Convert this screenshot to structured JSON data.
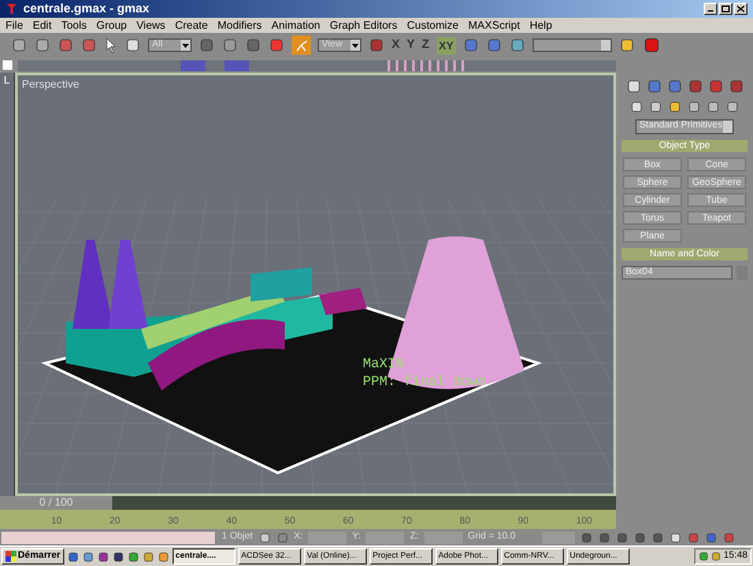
{
  "window": {
    "title": "centrale.gmax - gmax"
  },
  "menu": [
    "File",
    "Edit",
    "Tools",
    "Group",
    "Views",
    "Create",
    "Modifiers",
    "Animation",
    "Graph Editors",
    "Customize",
    "MAXScript",
    "Help"
  ],
  "toolbar": {
    "selection_filter": "All",
    "coordinate_system": "View",
    "axis_xy": "XY",
    "axis_x": "X",
    "axis_y": "Y",
    "axis_z": "Z"
  },
  "viewport": {
    "corner": "L",
    "label": "Perspective",
    "overlay_lines": [
      "MaXIN",
      "PPM: final down"
    ]
  },
  "command_panel": {
    "category": "Standard Primitives",
    "object_type": {
      "title": "Object Type",
      "buttons": [
        "Box",
        "Cone",
        "Sphere",
        "GeoSphere",
        "Cylinder",
        "Tube",
        "Torus",
        "Teapot",
        "Plane"
      ]
    },
    "name_and_color": {
      "title": "Name and Color",
      "name": "Box04",
      "color": "#7f7f7f"
    }
  },
  "time_slider": {
    "label": "0 / 100",
    "level": 0
  },
  "track_bar": {
    "ticks": [
      "10",
      "20",
      "30",
      "40",
      "50",
      "60",
      "70",
      "80",
      "90",
      "100"
    ]
  },
  "status_bar": {
    "selection": "1 Objet",
    "x_label": "X:",
    "y_label": "Y:",
    "z_label": "Z:",
    "grid": "Grid = 10.0"
  },
  "taskbar": {
    "start": "Démarrer",
    "tasks": [
      {
        "label": "centrale....",
        "selected": true
      },
      {
        "label": "ACDSee 32...",
        "selected": false
      },
      {
        "label": "Val (Online)...",
        "selected": false
      },
      {
        "label": "Project Perf...",
        "selected": false
      },
      {
        "label": "Adobe Phot...",
        "selected": false
      },
      {
        "label": "Comm-NRV...",
        "selected": false
      },
      {
        "label": "Undegroun...",
        "selected": false
      }
    ],
    "clock": "15:48"
  }
}
